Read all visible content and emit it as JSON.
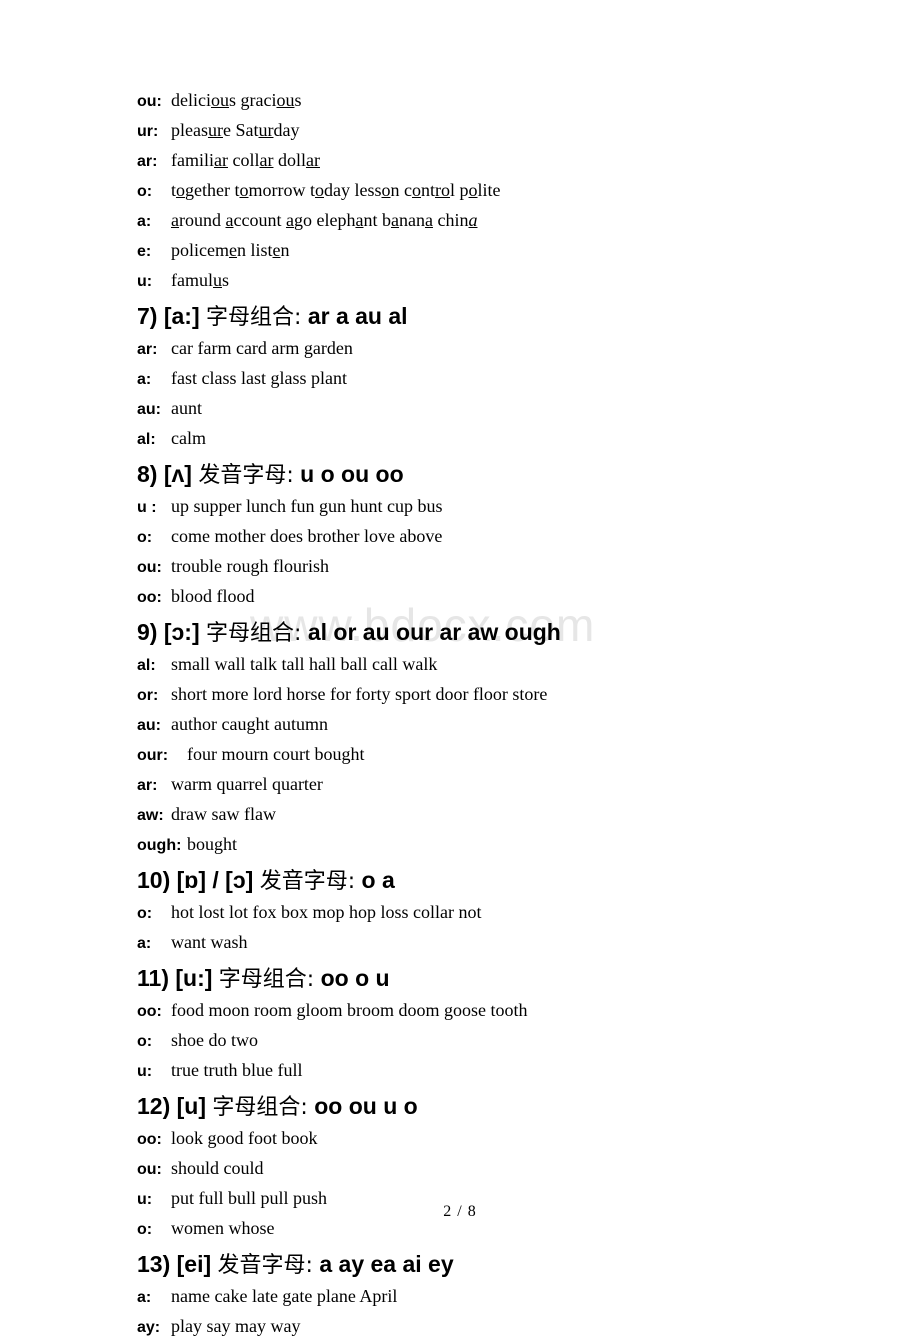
{
  "watermark": {
    "text": "www.bdocx.com"
  },
  "footer": {
    "page_label": "2 / 8"
  },
  "intro_rows": [
    {
      "label": "ou:",
      "words": "delici<u>ou</u>s graci<u>ou</u>s"
    },
    {
      "label": "ur:",
      "words": "pleas<u>ur</u>e Sat<u>ur</u>day"
    },
    {
      "label": "ar:",
      "words": "famili<u>ar</u> coll<u>ar</u> doll<u>ar</u>"
    },
    {
      "label": "o:",
      "words": "t<u>o</u>gether t<u>o</u>morrow t<u>o</u>day less<u>o</u>n c<u>o</u>nt<u>ro</u>l p<u>o</u>lite"
    },
    {
      "label": "a:",
      "words": "<u>a</u>round <u>a</u>ccount <u>a</u>go eleph<u>a</u>nt b<u>a</u>nan<u>a</u> chin<i><u>a</u></i>"
    },
    {
      "label": "e:",
      "words": "policem<u>e</u>n list<u>e</u>n"
    },
    {
      "label": "u:",
      "words": "famul<u>u</u>s"
    }
  ],
  "sections": [
    {
      "number": "7)",
      "phonetic": "[a:]",
      "chinese": "字母组合:",
      "combos": "ar   a   au   al",
      "rows": [
        {
          "label": "ar:",
          "words": "car     farm     card     arm     garden"
        },
        {
          "label": "a:",
          "words": "fast     class     last     glass     plant"
        },
        {
          "label": "au:",
          "words": "aunt"
        },
        {
          "label": "al:",
          "words": "calm"
        }
      ]
    },
    {
      "number": "8)",
      "phonetic": "[ʌ]",
      "chinese": "发音字母:",
      "combos": "u   o   ou   oo",
      "rows": [
        {
          "label": "u :",
          "words": "up   supper   lunch   fun   gun   hunt   cup   bus"
        },
        {
          "label": "o:",
          "words": "come   mother   does   brother   love   above"
        },
        {
          "label": "ou:",
          "words": "trouble   rough   flourish"
        },
        {
          "label": "oo:",
          "words": "blood     flood"
        }
      ]
    },
    {
      "number": "9)",
      "phonetic": "[ɔ:]",
      "chinese": "字母组合:",
      "combos": "al   or   au   our   ar   aw   ough",
      "rows": [
        {
          "label": "al:",
          "words": "small   wall   talk   tall   hall   ball   call   walk"
        },
        {
          "label": "or:",
          "words": "short   more   lord   horse   for   forty   sport   door   floor   store"
        },
        {
          "label": "au:",
          "words": "author   caught   autumn"
        },
        {
          "label": "our:",
          "words": "four   mourn   court   bought"
        },
        {
          "label": "ar:",
          "words": "warm   quarrel   quarter"
        },
        {
          "label": "aw:",
          "words": "draw saw flaw"
        },
        {
          "label": "ough:",
          "words": "bought"
        }
      ]
    },
    {
      "number": "10)",
      "phonetic": "[ɒ] / [ɔ]",
      "chinese": "发音字母:",
      "combos": "o   a",
      "rows": [
        {
          "label": "o:",
          "words": "hot lost lot fox box mop hop loss collar not"
        },
        {
          "label": "a:",
          "words": "want wash"
        }
      ]
    },
    {
      "number": "11)",
      "phonetic": "[u:]",
      "chinese": "字母组合:",
      "combos": "oo    o   u",
      "rows": [
        {
          "label": "oo:",
          "words": "food   moon   room   gloom   broom   doom   goose   tooth"
        },
        {
          "label": "o:",
          "words": "shoe   do   two"
        },
        {
          "label": "u:",
          "words": "true   truth   blue   full"
        }
      ]
    },
    {
      "number": "12)",
      "phonetic": "[u]",
      "chinese": "字母组合:",
      "combos": "oo   ou   u   o",
      "rows": [
        {
          "label": "oo:",
          "words": "look   good   foot   book"
        },
        {
          "label": "ou:",
          "words": "should   could"
        },
        {
          "label": "u:",
          "words": "put full   bull   pull   push"
        },
        {
          "label": "o:",
          "words": "women   whose"
        }
      ]
    },
    {
      "number": "13)",
      "phonetic": "[ei]",
      "chinese": "发音字母:",
      "combos": "a   ay   ea   ai   ey",
      "rows": [
        {
          "label": "a:",
          "words": "name    cake   late   gate   plane   April"
        },
        {
          "label": "ay:",
          "words": "play   say   may   way"
        }
      ]
    }
  ]
}
